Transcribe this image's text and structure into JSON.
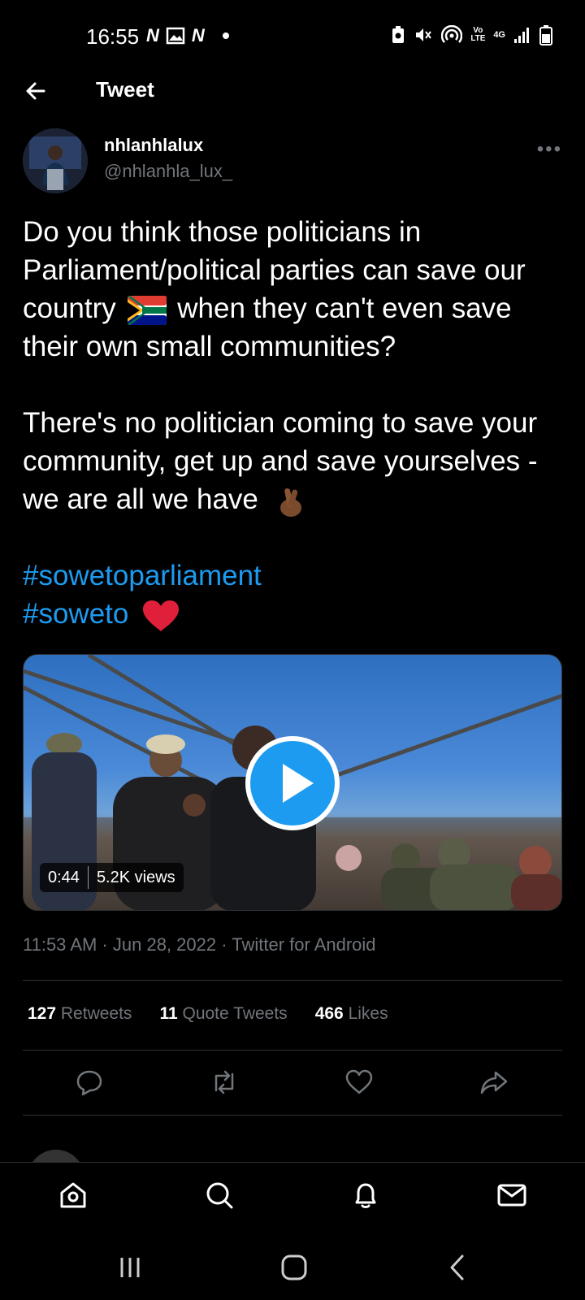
{
  "status_bar": {
    "time": "16:55",
    "left_icons": [
      "netflix-icon",
      "gallery-icon",
      "netflix-icon",
      "dot-icon"
    ],
    "right_icons": [
      "battery-saver-icon",
      "mute-icon",
      "hotspot-icon",
      "volte-icon",
      "4g-icon",
      "signal-icon",
      "battery-icon"
    ],
    "netflix_glyph": "N",
    "volte_label": "Vo LTE",
    "network_label": "4G"
  },
  "header": {
    "title": "Tweet",
    "back_icon": "back-arrow-icon"
  },
  "tweet": {
    "author_name": "nhlanhlalux",
    "author_handle": "@nhlanhla_lux_",
    "more_label": "•••",
    "text_line1": "Do you think those politicians in Parliament/political parties can save our country",
    "text_line1_after_flag": "when they can't even save their own small communities?",
    "text_para2": "There's no politician coming to save your community, get up and save yourselves - we are all we have",
    "hashtags": [
      "#sowetoparliament",
      "#soweto"
    ],
    "emoji_flag": "south-africa-flag",
    "emoji_fingers": "crossed-fingers",
    "emoji_heart": "red-heart",
    "timestamp": "11:53 AM · Jun 28, 2022 · Twitter for Android"
  },
  "video": {
    "duration": "0:44",
    "views": "5.2K views"
  },
  "stats": {
    "retweets_count": "127",
    "retweets_label": "Retweets",
    "quotes_count": "11",
    "quotes_label": "Quote Tweets",
    "likes_count": "466",
    "likes_label": "Likes"
  },
  "colors": {
    "accent": "#1d9bf0",
    "secondary_text": "#71767b",
    "divider": "#2f3336",
    "heart": "#f91880"
  }
}
